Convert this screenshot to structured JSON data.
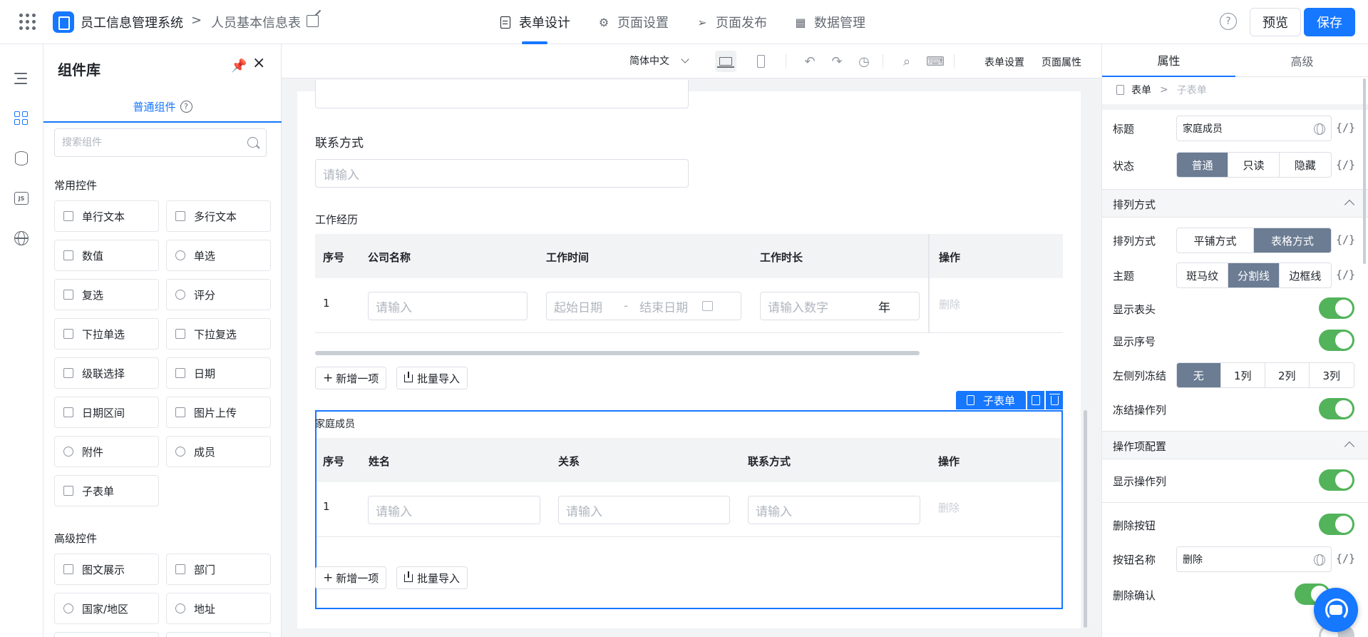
{
  "topbar": {
    "app_name": "员工信息管理系统",
    "separator": ">",
    "page_name": "人员基本信息表",
    "tabs": [
      {
        "label": "表单设计",
        "icon": "document-icon"
      },
      {
        "label": "页面设置",
        "icon": "gear-icon"
      },
      {
        "label": "页面发布",
        "icon": "send-icon"
      },
      {
        "label": "数据管理",
        "icon": "table-icon"
      }
    ],
    "help": "?",
    "preview_label": "预览",
    "save_label": "保存",
    "accent": "#1677ff"
  },
  "rail": {
    "items": [
      "outline-icon",
      "components-icon",
      "datasource-icon",
      "js-icon",
      "globe-icon"
    ],
    "js_label": "JS"
  },
  "library": {
    "title": "组件库",
    "tab": "普通组件",
    "tab_help": "?",
    "search_placeholder": "搜索组件",
    "sections": [
      {
        "title": "常用控件",
        "items": [
          "单行文本",
          "多行文本",
          "数值",
          "单选",
          "复选",
          "评分",
          "下拉单选",
          "下拉复选",
          "级联选择",
          "日期",
          "日期区间",
          "图片上传",
          "附件",
          "成员",
          "子表单"
        ]
      },
      {
        "title": "高级控件",
        "items": [
          "图文展示",
          "部门",
          "国家/地区",
          "地址"
        ]
      }
    ]
  },
  "toolbar": {
    "language": "简体中文",
    "form_settings": "表单设置",
    "page_props": "页面属性"
  },
  "form": {
    "contact_label": "联系方式",
    "contact_placeholder": "请输入",
    "work": {
      "title": "工作经历",
      "columns": [
        "序号",
        "公司名称",
        "工作时间",
        "工作时长",
        "操作"
      ],
      "row": {
        "index": "1",
        "company_placeholder": "请输入",
        "start_placeholder": "起始日期",
        "range_sep": "-",
        "end_placeholder": "结束日期",
        "duration_placeholder": "请输入数字",
        "unit": "年",
        "delete": "删除"
      },
      "add": "新增一项",
      "import": "批量导入"
    },
    "family": {
      "tag": "子表单",
      "title": "家庭成员",
      "columns": [
        "序号",
        "姓名",
        "关系",
        "联系方式",
        "操作"
      ],
      "row": {
        "index": "1",
        "name_placeholder": "请输入",
        "relation_placeholder": "请输入",
        "contact_placeholder": "请输入",
        "delete": "删除"
      },
      "add": "新增一项",
      "import": "批量导入"
    }
  },
  "props": {
    "tabs": [
      "属性",
      "高级"
    ],
    "crumb": {
      "root": "表单",
      "sep": ">",
      "current": "子表单"
    },
    "title_label": "标题",
    "title_value": "家庭成员",
    "var": "{/}",
    "status_label": "状态",
    "status_options": [
      "普通",
      "只读",
      "隐藏"
    ],
    "layout_group": "排列方式",
    "layout_label": "排列方式",
    "layout_options": [
      "平铺方式",
      "表格方式"
    ],
    "theme_label": "主题",
    "theme_options": [
      "斑马纹",
      "分割线",
      "边框线"
    ],
    "show_header": "显示表头",
    "show_index": "显示序号",
    "freeze_label": "左侧列冻结",
    "freeze_options": [
      "无",
      "1列",
      "2列",
      "3列"
    ],
    "freeze_ops": "冻结操作列",
    "ops_group": "操作项配置",
    "show_ops": "显示操作列",
    "delete_btn": "删除按钮",
    "btn_name_label": "按钮名称",
    "btn_name_value": "删除",
    "delete_confirm": "删除确认",
    "toggle_color": "#52b35a",
    "selected_color": "#6b7c93"
  }
}
